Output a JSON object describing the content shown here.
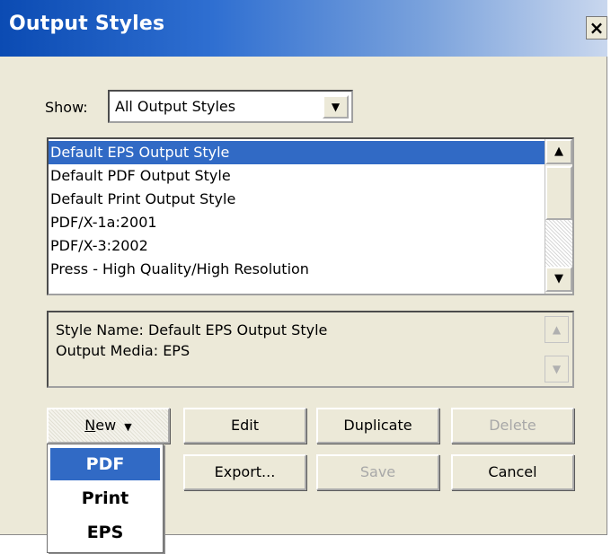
{
  "window": {
    "title": "Output Styles",
    "close_glyph": "×"
  },
  "show": {
    "label": "Show:",
    "selected": "All Output Styles",
    "arrow": "▼"
  },
  "styles_list": {
    "items": [
      "Default EPS Output Style",
      "Default PDF Output Style",
      "Default Print Output Style",
      "PDF/X-1a:2001",
      "PDF/X-3:2002",
      "Press - High Quality/High Resolution"
    ],
    "selected_index": 0,
    "scroll_up": "▲",
    "scroll_down": "▼"
  },
  "info": {
    "style_name": "Style Name: Default EPS Output Style",
    "output_media": "Output Media: EPS",
    "scroll_up": "▲",
    "scroll_down": "▼"
  },
  "buttons": {
    "new_mnemonic": "N",
    "new_rest": "ew",
    "new_arrow": "▼",
    "edit": "Edit",
    "duplicate": "Duplicate",
    "delete": "Delete",
    "export": "Export...",
    "save": "Save",
    "cancel": "Cancel"
  },
  "new_menu": {
    "items": [
      "PDF",
      "Print",
      "EPS"
    ],
    "active_index": 0
  },
  "colors": {
    "selection": "#316ac5",
    "dialog_bg": "#ece9d8",
    "title_start": "#0b4bb3"
  }
}
